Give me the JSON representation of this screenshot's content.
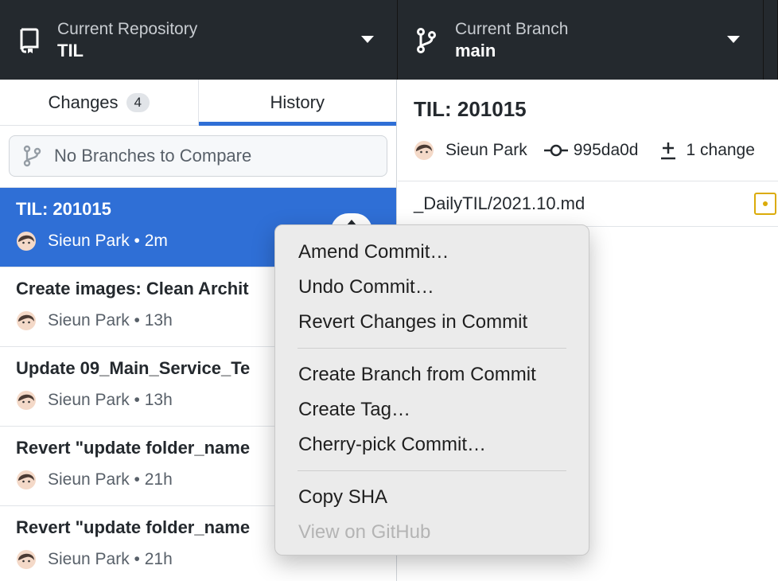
{
  "toolbar": {
    "repository": {
      "label": "Current Repository",
      "value": "TIL",
      "icon": "repo-icon"
    },
    "branch": {
      "label": "Current Branch",
      "value": "main",
      "icon": "git-branch-icon"
    }
  },
  "sidebar": {
    "tabs": [
      {
        "label": "Changes",
        "badge": "4"
      },
      {
        "label": "History"
      }
    ],
    "compare": {
      "label": "No Branches to Compare"
    },
    "commits": [
      {
        "title": "TIL: 201015",
        "meta": "Sieun Park • 2m"
      },
      {
        "title": "Create images: Clean Archit",
        "meta": "Sieun Park • 13h"
      },
      {
        "title": "Update 09_Main_Service_Te",
        "meta": "Sieun Park • 13h"
      },
      {
        "title": "Revert \"update folder_name",
        "meta": "Sieun Park • 21h"
      },
      {
        "title": "Revert \"update folder_name",
        "meta": "Sieun Park • 21h"
      }
    ]
  },
  "main": {
    "title": "TIL: 201015",
    "author": "Sieun Park",
    "sha": "995da0d",
    "changes": "1 change",
    "file": {
      "path": "_DailyTIL/2021.10.md",
      "status_color": "#dbab09"
    }
  },
  "context_menu": {
    "groups": [
      [
        "Amend Commit…",
        "Undo Commit…",
        "Revert Changes in Commit"
      ],
      [
        "Create Branch from Commit",
        "Create Tag…",
        "Cherry-pick Commit…"
      ],
      [
        "Copy SHA",
        "View on GitHub"
      ]
    ]
  },
  "colors": {
    "accent": "#2f6fd6",
    "toolbar": "#24292e"
  }
}
